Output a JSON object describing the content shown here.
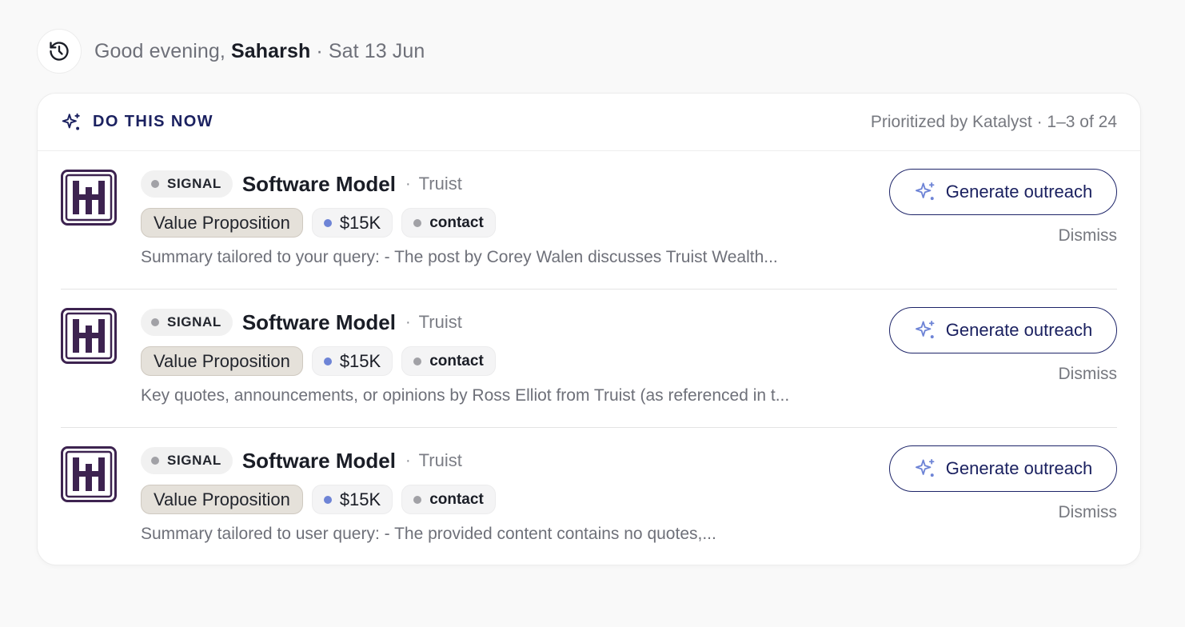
{
  "greeting": {
    "prefix": "Good evening, ",
    "name": "Saharsh",
    "date": " · Sat 13 Jun",
    "history_icon": "history-icon"
  },
  "panel": {
    "title": "DO THIS NOW",
    "title_icon": "sparkle-icon",
    "meta": "Prioritized by Katalyst · 1–3 of 24"
  },
  "items": [
    {
      "badge": "SIGNAL",
      "title": "Software Model",
      "separator": "·",
      "company": "Truist",
      "category": "Value Proposition",
      "value": "$15K",
      "contact": "contact",
      "summary": "Summary tailored to your query: - The post by Corey Walen discusses Truist Wealth...",
      "primary_action": "Generate outreach",
      "secondary_action": "Dismiss"
    },
    {
      "badge": "SIGNAL",
      "title": "Software Model",
      "separator": "·",
      "company": "Truist",
      "category": "Value Proposition",
      "value": "$15K",
      "contact": "contact",
      "summary": "Key quotes, announcements, or opinions by Ross Elliot from Truist (as referenced in t...",
      "primary_action": "Generate outreach",
      "secondary_action": "Dismiss"
    },
    {
      "badge": "SIGNAL",
      "title": "Software Model",
      "separator": "·",
      "company": "Truist",
      "category": "Value Proposition",
      "value": "$15K",
      "contact": "contact",
      "summary": "Summary tailored to user query: - The provided content contains no quotes,...",
      "primary_action": "Generate outreach",
      "secondary_action": "Dismiss"
    }
  ],
  "colors": {
    "accent_navy": "#1b2160",
    "logo_purple": "#3d2350",
    "value_dot": "#6e84d6",
    "status_dot": "#a1a1a6"
  }
}
